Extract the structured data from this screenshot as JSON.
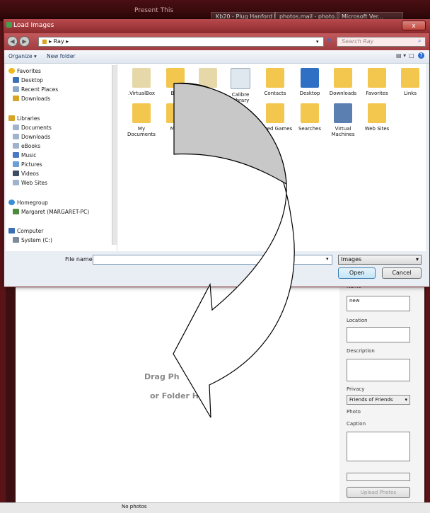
{
  "background": {
    "title": "Present This",
    "tabs": [
      "Kb20 - Plug Hanford Mou...",
      "photos.mail - photo...",
      "Microsoft Ver..."
    ],
    "right_panel": {
      "name_label": "Name *",
      "name_value": "new",
      "location_label": "Location",
      "description_label": "Description",
      "privacy_label": "Privacy",
      "privacy_value": "Friends of Friends",
      "photo_label": "Photo",
      "caption_label": "Caption",
      "upload_button": "Upload Photos"
    },
    "drop_line1": "Drag Ph",
    "drop_line2": "or Folder He",
    "status": "No photos"
  },
  "dialog": {
    "title": "Load Images",
    "close_label": "x",
    "address": "Ray",
    "search_placeholder": "Search Ray",
    "organize": "Organize ▾",
    "new_folder": "New folder",
    "nav": {
      "favorites": "Favorites",
      "favorites_items": [
        "Desktop",
        "Recent Places",
        "Downloads"
      ],
      "libraries": "Libraries",
      "libraries_items": [
        "Documents",
        "Downloads",
        "eBooks",
        "Music",
        "Pictures",
        "Videos",
        "Web Sites"
      ],
      "homegroup": "Homegroup",
      "homegroup_items": [
        "Margaret (MARGARET-PC)"
      ],
      "computer": "Computer",
      "computer_items": [
        "System (C:)"
      ]
    },
    "files_row1": [
      ".VirtualBox",
      "Bac",
      "",
      "Calibre Library",
      "Contacts",
      "Desktop",
      "Downloads",
      "Favorites",
      "Links"
    ],
    "files_row2": [
      "My Documents",
      "My I",
      "",
      "",
      "Saved Games",
      "Searches",
      "Virtual Machines",
      "Web Sites"
    ],
    "file_name_label": "File name:",
    "file_name_value": "",
    "filter": "Images",
    "open_button": "Open",
    "cancel_button": "Cancel"
  },
  "colors": {
    "accent": "#b84a4d",
    "frame": "#5a1418",
    "folder": "#f3c64e"
  }
}
